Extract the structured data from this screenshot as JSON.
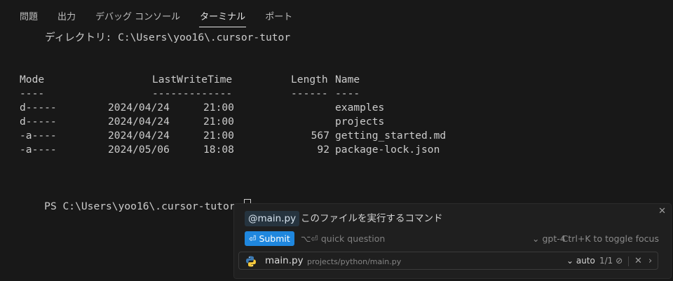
{
  "tabs": [
    {
      "label": "問題"
    },
    {
      "label": "出力"
    },
    {
      "label": "デバッグ コンソール"
    },
    {
      "label": "ターミナル",
      "active": true
    },
    {
      "label": "ポート"
    }
  ],
  "terminal": {
    "directory_line": "ディレクトリ: C:\\Users\\yoo16\\.cursor-tutor",
    "headers": {
      "mode": "Mode",
      "lastwrite": "LastWriteTime",
      "length": "Length",
      "name": "Name"
    },
    "underlines": {
      "mode": "----",
      "lastwrite": "-------------",
      "length": "------",
      "name": "----"
    },
    "rows": [
      {
        "mode": "d-----",
        "date": "2024/04/24",
        "time": "21:00",
        "length": "",
        "name": "examples"
      },
      {
        "mode": "d-----",
        "date": "2024/04/24",
        "time": "21:00",
        "length": "",
        "name": "projects"
      },
      {
        "mode": "-a----",
        "date": "2024/04/24",
        "time": "21:00",
        "length": "567",
        "name": "getting_started.md"
      },
      {
        "mode": "-a----",
        "date": "2024/05/06",
        "time": "18:08",
        "length": "92",
        "name": "package-lock.json"
      }
    ],
    "prompt": "PS C:\\Users\\yoo16\\.cursor-tutor>"
  },
  "panel": {
    "mention": "@main.py",
    "prompt_text": "このファイルを実行するコマンド",
    "submit_label": "⏎ Submit",
    "quick_hint": "⌥⏎ quick question",
    "model_label": "⌄ gpt-4",
    "toggle_hint": "Ctrl+K to toggle focus",
    "file": {
      "name": "main.py",
      "path": "projects/python/main.py",
      "auto_label": "⌄ auto",
      "count": "1/1"
    },
    "colors": {
      "accent": "#1f87de",
      "chip_bg": "#26343f"
    }
  }
}
